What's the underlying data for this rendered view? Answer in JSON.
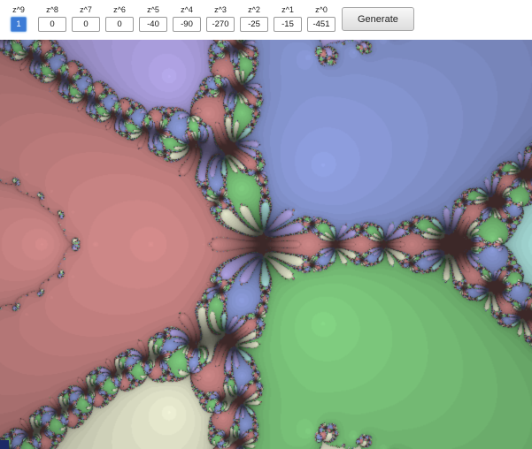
{
  "toolbar": {
    "fields": [
      {
        "label": "z^9",
        "value": "1"
      },
      {
        "label": "z^8",
        "value": "0"
      },
      {
        "label": "z^7",
        "value": "0"
      },
      {
        "label": "z^6",
        "value": "0"
      },
      {
        "label": "z^5",
        "value": "-40"
      },
      {
        "label": "z^4",
        "value": "-90"
      },
      {
        "label": "z^3",
        "value": "-270"
      },
      {
        "label": "z^2",
        "value": "-25"
      },
      {
        "label": "z^1",
        "value": "-15"
      },
      {
        "label": "z^0",
        "value": "-451"
      }
    ],
    "generate_label": "Generate"
  },
  "fractal": {
    "type": "newton-fractal",
    "coefficients": [
      1,
      0,
      0,
      0,
      -40,
      -90,
      -270,
      -25,
      -15,
      -451
    ],
    "view": {
      "center_re": 0,
      "center_im": 0,
      "pixels_per_unit": 100
    },
    "max_iterations": 28,
    "palette": [
      {
        "angle_deg": 0,
        "color": "#9fd2ce"
      },
      {
        "angle_deg": 45,
        "color": "#8a9ad8"
      },
      {
        "angle_deg": 100,
        "color": "#ab9fde"
      },
      {
        "angle_deg": 140,
        "color": "#d29090"
      },
      {
        "angle_deg": 172,
        "color": "#c98484"
      },
      {
        "angle_deg": 188,
        "color": "#cc8a8a"
      },
      {
        "angle_deg": 220,
        "color": "#cdd0a2"
      },
      {
        "angle_deg": 260,
        "color": "#e0e2c8"
      },
      {
        "angle_deg": 315,
        "color": "#7cc87c"
      }
    ]
  }
}
